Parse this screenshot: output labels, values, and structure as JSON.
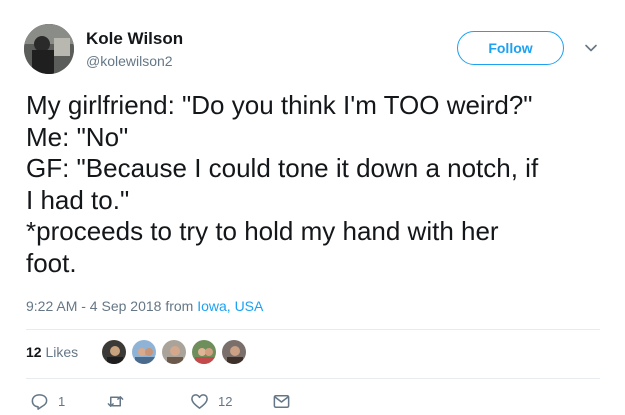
{
  "user": {
    "name": "Kole Wilson",
    "handle": "@kolewilson2",
    "follow_label": "Follow"
  },
  "tweet": {
    "lines": [
      "My girlfriend: \"Do you think I'm TOO weird?\"",
      "Me: \"No\"",
      "GF: \"Because I could tone it down a notch, if",
      "I had to.\"",
      "*proceeds to try to hold my hand with her",
      "foot."
    ],
    "timestamp": "9:22 AM - 4 Sep 2018",
    "from_label": "from",
    "location": "Iowa, USA"
  },
  "stats": {
    "likes_count": "12",
    "likes_label": "Likes"
  },
  "actions": {
    "reply_count": "1",
    "retweet_count": "",
    "like_count": "12"
  },
  "colors": {
    "accent": "#1da1f2",
    "secondary_text": "#657786",
    "divider": "#e6ecf0"
  },
  "icons": [
    "chevron-down-icon",
    "reply-icon",
    "retweet-icon",
    "heart-icon",
    "message-icon"
  ]
}
